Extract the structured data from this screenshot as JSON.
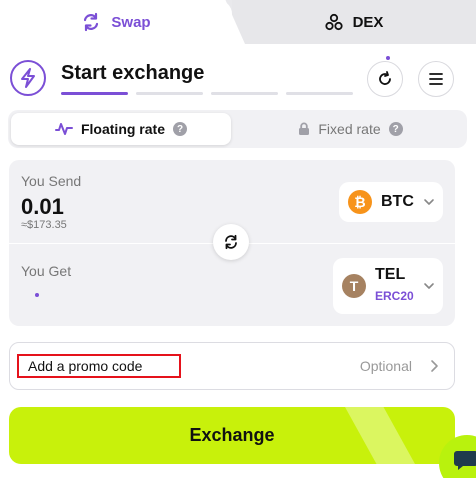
{
  "tabs": {
    "swap_label": "Swap",
    "dex_label": "DEX"
  },
  "header": {
    "title": "Start exchange",
    "progress_steps": 4,
    "active_step": 1
  },
  "rate": {
    "floating_label": "Floating rate",
    "fixed_label": "Fixed rate",
    "selected": "floating"
  },
  "send": {
    "label": "You Send",
    "amount": "0.01",
    "usd_value": "≈$173.35",
    "currency": "BTC"
  },
  "get": {
    "label": "You Get",
    "currency": "TEL",
    "network": "ERC20"
  },
  "promo": {
    "label": "Add a promo code",
    "optional": "Optional"
  },
  "exchange_button": {
    "label": "Exchange"
  },
  "colors": {
    "accent_purple": "#7b4fd6",
    "exchange_green": "#c8f10b",
    "btc_orange": "#f7931a",
    "tel_brown": "#a68261",
    "promo_highlight": "#e5121b"
  },
  "icons": {
    "swap_tab": "swap-arrows-icon",
    "dex_tab": "dex-nodes-icon",
    "logo": "lightning-bolt-icon",
    "refresh": "refresh-icon",
    "menu": "hamburger-menu-icon",
    "floating": "pulse-wave-icon",
    "fixed": "lock-icon",
    "help": "question-icon",
    "swap_direction": "swap-direction-icon",
    "chevron": "chevron-down-icon",
    "chat": "chat-bubble-icon"
  }
}
